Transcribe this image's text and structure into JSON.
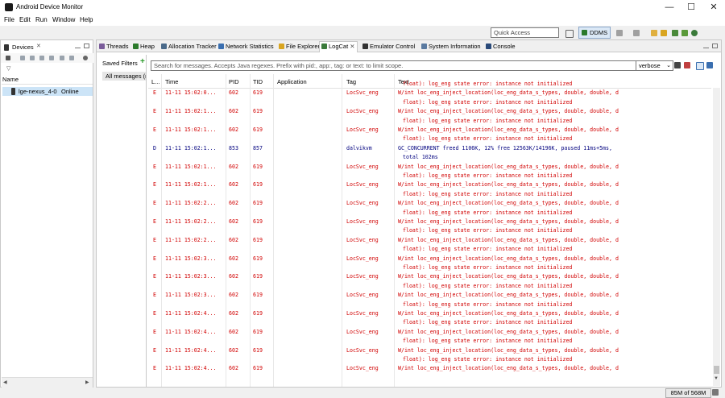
{
  "window": {
    "title": "Android Device Monitor",
    "controls": [
      "—",
      "☐",
      "✕"
    ]
  },
  "menu": [
    "File",
    "Edit",
    "Run",
    "Window",
    "Help"
  ],
  "toolbar": {
    "quick_access_placeholder": "Quick Access",
    "perspective": "DDMS"
  },
  "devices_view": {
    "tab_label": "Devices",
    "column_name": "Name",
    "device": {
      "name": "lge-nexus_4-0",
      "status": "Online"
    }
  },
  "view_tabs": [
    {
      "label": "Threads",
      "icon": "threads-icon",
      "color": "#7a5c9a"
    },
    {
      "label": "Heap",
      "icon": "heap-icon",
      "color": "#2b7a2b"
    },
    {
      "label": "Allocation Tracker",
      "icon": "allocation-icon",
      "color": "#4a6a8a"
    },
    {
      "label": "Network Statistics",
      "icon": "network-icon",
      "color": "#3a6fb0"
    },
    {
      "label": "File Explorer",
      "icon": "folder-icon",
      "color": "#d9a520"
    },
    {
      "label": "LogCat",
      "icon": "logcat-icon",
      "color": "#3a7a3a",
      "active": true
    },
    {
      "label": "Emulator Control",
      "icon": "emulator-icon",
      "color": "#333333"
    },
    {
      "label": "System Information",
      "icon": "sysinfo-icon",
      "color": "#5a7aa0"
    },
    {
      "label": "Console",
      "icon": "console-icon",
      "color": "#2a4a7a"
    }
  ],
  "logcat": {
    "saved_filters_label": "Saved Filters",
    "saved_filters": [
      "All messages (no filters)"
    ],
    "search_placeholder": "Search for messages. Accepts Java regexes. Prefix with pid:, app:, tag: or text: to limit scope.",
    "log_level": "verbose",
    "columns": [
      "L...",
      "Time",
      "PID",
      "TID",
      "Application",
      "Tag",
      "Text"
    ],
    "rows": [
      {
        "level": "",
        "time": "",
        "pid": "",
        "tid": "",
        "app": "",
        "tag": "",
        "text": "float): log_eng state error: instance not initialized",
        "cont": true
      },
      {
        "level": "E",
        "time": "11-11 15:02:0...",
        "pid": "602",
        "tid": "619",
        "app": "",
        "tag": "LocSvc_eng",
        "text": "W/int loc_eng_inject_location(loc_eng_data_s_types, double, double, d"
      },
      {
        "level": "",
        "time": "",
        "pid": "",
        "tid": "",
        "app": "",
        "tag": "",
        "text": "float): log_eng state error: instance not initialized",
        "cont": true
      },
      {
        "level": "E",
        "time": "11-11 15:02:1...",
        "pid": "602",
        "tid": "619",
        "app": "",
        "tag": "LocSvc_eng",
        "text": "W/int loc_eng_inject_location(loc_eng_data_s_types, double, double, d"
      },
      {
        "level": "",
        "time": "",
        "pid": "",
        "tid": "",
        "app": "",
        "tag": "",
        "text": "float): log_eng state error: instance not initialized",
        "cont": true
      },
      {
        "level": "E",
        "time": "11-11 15:02:1...",
        "pid": "602",
        "tid": "619",
        "app": "",
        "tag": "LocSvc_eng",
        "text": "W/int loc_eng_inject_location(loc_eng_data_s_types, double, double, d"
      },
      {
        "level": "",
        "time": "",
        "pid": "",
        "tid": "",
        "app": "",
        "tag": "",
        "text": "float): log_eng state error: instance not initialized",
        "cont": true
      },
      {
        "level": "D",
        "time": "11-11 15:02:1...",
        "pid": "853",
        "tid": "857",
        "app": "",
        "tag": "dalvikvm",
        "text": "GC_CONCURRENT freed 1106K, 12% free 12563K/14196K, paused 11ms+5ms,"
      },
      {
        "level": "",
        "time": "",
        "pid": "",
        "tid": "",
        "app": "",
        "tag": "",
        "text": "total 102ms",
        "cont": true,
        "dlevel": true
      },
      {
        "level": "E",
        "time": "11-11 15:02:1...",
        "pid": "602",
        "tid": "619",
        "app": "",
        "tag": "LocSvc_eng",
        "text": "W/int loc_eng_inject_location(loc_eng_data_s_types, double, double, d"
      },
      {
        "level": "",
        "time": "",
        "pid": "",
        "tid": "",
        "app": "",
        "tag": "",
        "text": "float): log_eng state error: instance not initialized",
        "cont": true
      },
      {
        "level": "E",
        "time": "11-11 15:02:1...",
        "pid": "602",
        "tid": "619",
        "app": "",
        "tag": "LocSvc_eng",
        "text": "W/int loc_eng_inject_location(loc_eng_data_s_types, double, double, d"
      },
      {
        "level": "",
        "time": "",
        "pid": "",
        "tid": "",
        "app": "",
        "tag": "",
        "text": "float): log_eng state error: instance not initialized",
        "cont": true
      },
      {
        "level": "E",
        "time": "11-11 15:02:2...",
        "pid": "602",
        "tid": "619",
        "app": "",
        "tag": "LocSvc_eng",
        "text": "W/int loc_eng_inject_location(loc_eng_data_s_types, double, double, d"
      },
      {
        "level": "",
        "time": "",
        "pid": "",
        "tid": "",
        "app": "",
        "tag": "",
        "text": "float): log_eng state error: instance not initialized",
        "cont": true
      },
      {
        "level": "E",
        "time": "11-11 15:02:2...",
        "pid": "602",
        "tid": "619",
        "app": "",
        "tag": "LocSvc_eng",
        "text": "W/int loc_eng_inject_location(loc_eng_data_s_types, double, double, d"
      },
      {
        "level": "",
        "time": "",
        "pid": "",
        "tid": "",
        "app": "",
        "tag": "",
        "text": "float): log_eng state error: instance not initialized",
        "cont": true
      },
      {
        "level": "E",
        "time": "11-11 15:02:2...",
        "pid": "602",
        "tid": "619",
        "app": "",
        "tag": "LocSvc_eng",
        "text": "W/int loc_eng_inject_location(loc_eng_data_s_types, double, double, d"
      },
      {
        "level": "",
        "time": "",
        "pid": "",
        "tid": "",
        "app": "",
        "tag": "",
        "text": "float): log_eng state error: instance not initialized",
        "cont": true
      },
      {
        "level": "E",
        "time": "11-11 15:02:3...",
        "pid": "602",
        "tid": "619",
        "app": "",
        "tag": "LocSvc_eng",
        "text": "W/int loc_eng_inject_location(loc_eng_data_s_types, double, double, d"
      },
      {
        "level": "",
        "time": "",
        "pid": "",
        "tid": "",
        "app": "",
        "tag": "",
        "text": "float): log_eng state error: instance not initialized",
        "cont": true
      },
      {
        "level": "E",
        "time": "11-11 15:02:3...",
        "pid": "602",
        "tid": "619",
        "app": "",
        "tag": "LocSvc_eng",
        "text": "W/int loc_eng_inject_location(loc_eng_data_s_types, double, double, d"
      },
      {
        "level": "",
        "time": "",
        "pid": "",
        "tid": "",
        "app": "",
        "tag": "",
        "text": "float): log_eng state error: instance not initialized",
        "cont": true
      },
      {
        "level": "E",
        "time": "11-11 15:02:3...",
        "pid": "602",
        "tid": "619",
        "app": "",
        "tag": "LocSvc_eng",
        "text": "W/int loc_eng_inject_location(loc_eng_data_s_types, double, double, d"
      },
      {
        "level": "",
        "time": "",
        "pid": "",
        "tid": "",
        "app": "",
        "tag": "",
        "text": "float): log_eng state error: instance not initialized",
        "cont": true
      },
      {
        "level": "E",
        "time": "11-11 15:02:4...",
        "pid": "602",
        "tid": "619",
        "app": "",
        "tag": "LocSvc_eng",
        "text": "W/int loc_eng_inject_location(loc_eng_data_s_types, double, double, d"
      },
      {
        "level": "",
        "time": "",
        "pid": "",
        "tid": "",
        "app": "",
        "tag": "",
        "text": "float): log_eng state error: instance not initialized",
        "cont": true
      },
      {
        "level": "E",
        "time": "11-11 15:02:4...",
        "pid": "602",
        "tid": "619",
        "app": "",
        "tag": "LocSvc_eng",
        "text": "W/int loc_eng_inject_location(loc_eng_data_s_types, double, double, d"
      },
      {
        "level": "",
        "time": "",
        "pid": "",
        "tid": "",
        "app": "",
        "tag": "",
        "text": "float): log_eng state error: instance not initialized",
        "cont": true
      },
      {
        "level": "E",
        "time": "11-11 15:02:4...",
        "pid": "602",
        "tid": "619",
        "app": "",
        "tag": "LocSvc_eng",
        "text": "W/int loc_eng_inject_location(loc_eng_data_s_types, double, double, d"
      },
      {
        "level": "",
        "time": "",
        "pid": "",
        "tid": "",
        "app": "",
        "tag": "",
        "text": "float): log_eng state error: instance not initialized",
        "cont": true
      },
      {
        "level": "E",
        "time": "11-11 15:02:4...",
        "pid": "602",
        "tid": "619",
        "app": "",
        "tag": "LocSvc_eng",
        "text": "W/int loc_eng_inject_location(loc_eng_data_s_types, double, double, d"
      }
    ]
  },
  "status": {
    "memory": "85M of 568M"
  },
  "colors": {
    "error": "#d10000",
    "debug": "#00007f",
    "selection": "#cce4f7"
  }
}
